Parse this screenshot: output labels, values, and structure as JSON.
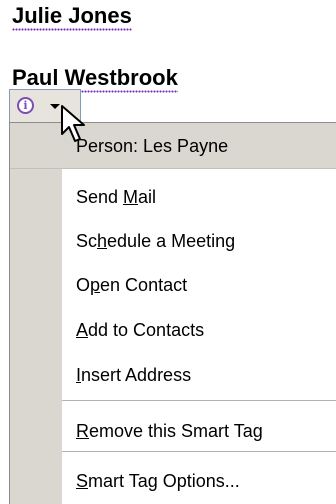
{
  "document": {
    "names": [
      "Julie Jones",
      "Paul Westbrook"
    ]
  },
  "smart_tag": {
    "info_icon_glyph": "i",
    "icon_names": [
      "info-icon",
      "chevron-down-icon"
    ],
    "accent_color": "#7d4fb3"
  },
  "menu": {
    "header": "Person: Les Payne",
    "items": [
      {
        "label": "Send Mail",
        "mnemonic": "M"
      },
      {
        "label": "Schedule a Meeting",
        "mnemonic": "h"
      },
      {
        "label": "Open Contact",
        "mnemonic": "p"
      },
      {
        "label": "Add to Contacts",
        "mnemonic": "A"
      },
      {
        "label": "Insert Address",
        "mnemonic": "I"
      },
      {
        "label": "Remove this Smart Tag",
        "mnemonic": "R"
      },
      {
        "label": "Smart Tag Options...",
        "mnemonic": "S"
      }
    ]
  }
}
